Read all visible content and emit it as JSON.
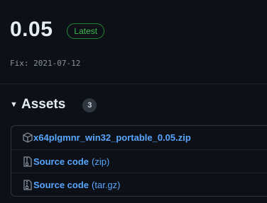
{
  "release": {
    "version": "0.05",
    "badge": "Latest",
    "notes": "Fix: 2021-07-12"
  },
  "assets": {
    "title": "Assets",
    "count": "3",
    "items": [
      {
        "name": "x64plgmnr_win32_portable_0.05.zip",
        "suffix": "",
        "icon": "package-icon"
      },
      {
        "name": "Source code",
        "suffix": "(zip)",
        "icon": "file-zip-icon"
      },
      {
        "name": "Source code",
        "suffix": "(tar.gz)",
        "icon": "file-zip-icon"
      }
    ]
  },
  "colors": {
    "background": "#0d1117",
    "link": "#58a6ff",
    "badge_green": "#3fb950",
    "border": "#30363d"
  }
}
